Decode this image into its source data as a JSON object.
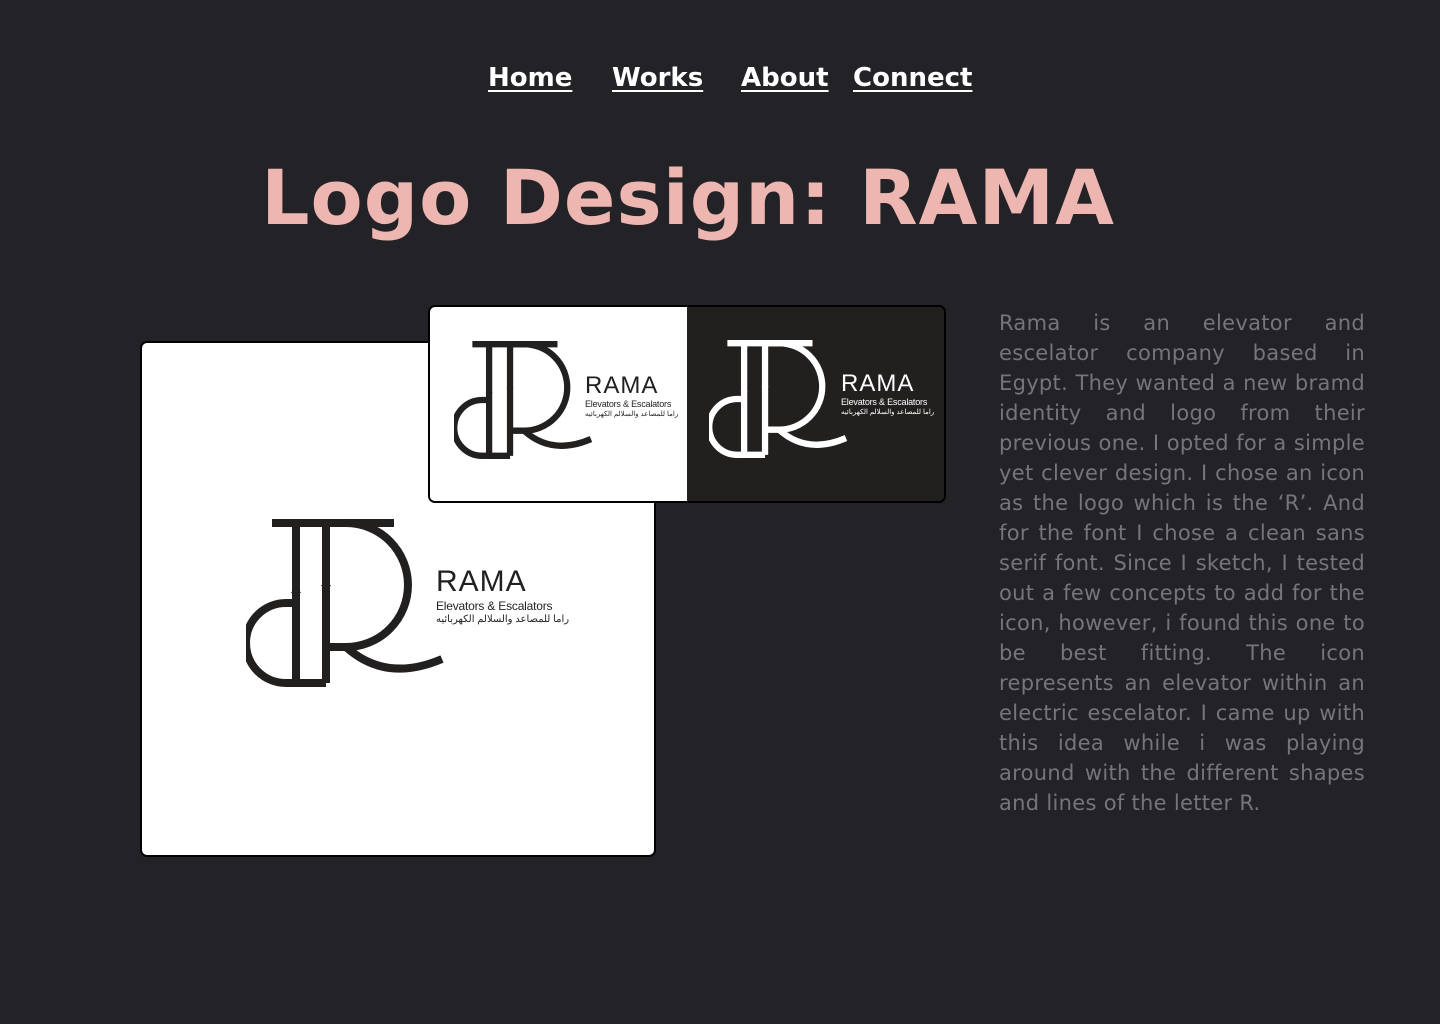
{
  "nav": {
    "home": "Home",
    "works": "Works",
    "about": "About",
    "connect": "Connect"
  },
  "page_title": "Logo Design: RAMA",
  "logo": {
    "name": "RAMA",
    "tagline": "Elevators & Escalators",
    "arabic": "راما للمصاعد والسلالم الكهربائيه"
  },
  "description": "Rama is an elevator and escelator company based in Egypt. They wanted a new bramd identity and logo from their previous one. I opted for a simple yet clever design. I chose an icon as the logo which is the ‘R’. And for the font I chose a clean sans serif font. Since I sketch, I tested out a few concepts to add for the icon, however, i found this one to be best fitting. The icon represents an elevator within an electric escelator. I came up with this idea while i was playing around with the different shapes and lines of the letter R.",
  "colors": {
    "background": "#232227",
    "title": "#edb6b1",
    "nav": "#ffffff",
    "description": "#76757a",
    "logo_dark": "#221f1f",
    "logo_light": "#ffffff"
  }
}
